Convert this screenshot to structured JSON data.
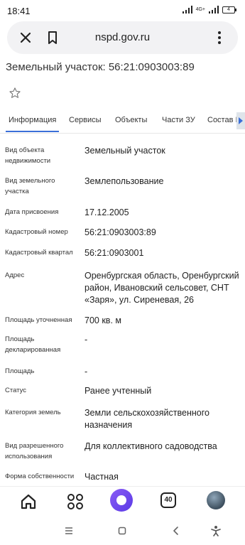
{
  "status": {
    "time": "18:41",
    "network": "4G+",
    "battery": "4"
  },
  "browser": {
    "url": "nspd.gov.ru",
    "tab_count": "40"
  },
  "page": {
    "title": "Земельный участок: 56:21:0903003:89"
  },
  "tabs": [
    {
      "label": "Информация",
      "active": true
    },
    {
      "label": "Сервисы",
      "active": false
    },
    {
      "label": "Объекты",
      "active": false
    },
    {
      "label": "Части ЗУ",
      "active": false
    },
    {
      "label": "Состав I",
      "active": false
    }
  ],
  "properties": [
    {
      "label": "Вид объекта недвижимости",
      "value": "Земельный участок"
    },
    {
      "label": "Вид земельного участка",
      "value": "Землепользование"
    },
    {
      "label": "Дата присвоения",
      "value": "17.12.2005"
    },
    {
      "label": "Кадастровый номер",
      "value": "56:21:0903003:89"
    },
    {
      "label": "Кадастровый квартал",
      "value": "56:21:0903001"
    },
    {
      "label": "Адрес",
      "value": "Оренбургская область, Оренбургский район, Ивановский сельсовет, СНТ «Заря», ул. Сиреневая, 26"
    },
    {
      "label": "Площадь уточненная",
      "value": "700 кв. м"
    },
    {
      "label": "Площадь декларированная",
      "value": "-"
    },
    {
      "label": "Площадь",
      "value": "-"
    },
    {
      "label": "Статус",
      "value": "Ранее учтенный"
    },
    {
      "label": "Категория земель",
      "value": "Земли сельскохозяйственного назначения"
    },
    {
      "label": "Вид разрешенного использования",
      "value": "Для коллективного садоводства"
    },
    {
      "label": "Форма собственности",
      "value": "Частная"
    }
  ],
  "colors": {
    "accent": "#3b6fd8",
    "alice": "#6a45ee",
    "url_bar_bg": "#f2f2f4"
  }
}
